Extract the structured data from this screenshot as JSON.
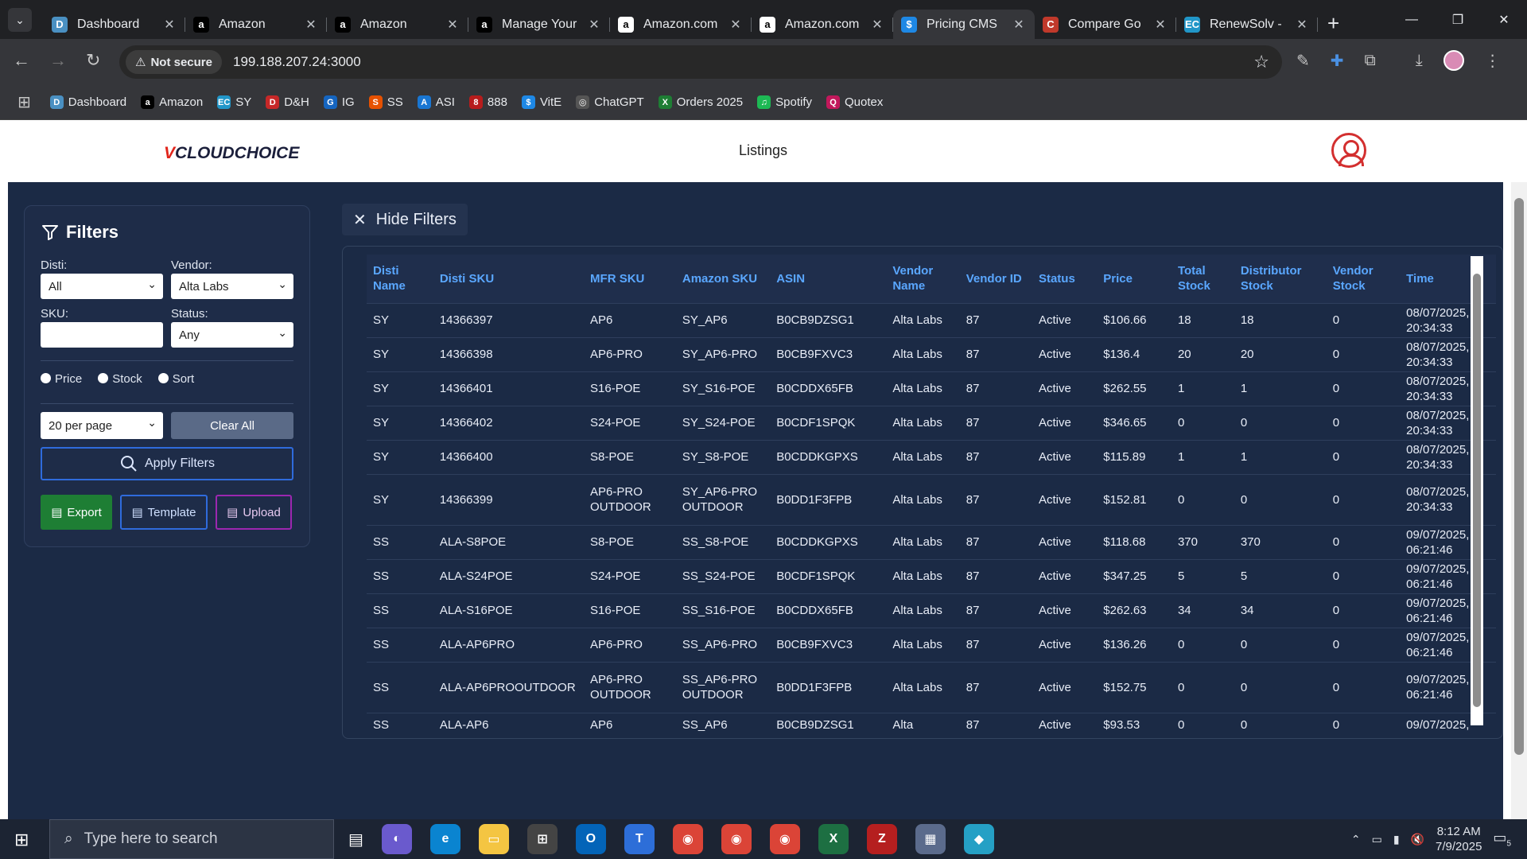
{
  "browser": {
    "tabs": [
      {
        "title": "Dashboard",
        "color": "#4a90c2",
        "glyph": "D"
      },
      {
        "title": "Amazon",
        "color": "#000000",
        "glyph": "a"
      },
      {
        "title": "Amazon",
        "color": "#000000",
        "glyph": "a"
      },
      {
        "title": "Manage Your",
        "color": "#000000",
        "glyph": "a"
      },
      {
        "title": "Amazon.com",
        "color": "#ffffff",
        "glyph": "a"
      },
      {
        "title": "Amazon.com",
        "color": "#ffffff",
        "glyph": "a"
      },
      {
        "title": "Pricing CMS",
        "color": "#1e88e5",
        "glyph": "$",
        "active": true
      },
      {
        "title": "Compare Go",
        "color": "#c0392b",
        "glyph": "C"
      },
      {
        "title": "RenewSolv -",
        "color": "#2196c8",
        "glyph": "EC"
      }
    ],
    "security_label": "Not secure",
    "url": "199.188.207.24:3000",
    "bookmarks": [
      {
        "label": "Dashboard",
        "color": "#4a90c2",
        "glyph": "D"
      },
      {
        "label": "Amazon",
        "color": "#000000",
        "glyph": "a"
      },
      {
        "label": "SY",
        "color": "#2196c8",
        "glyph": "EC"
      },
      {
        "label": "D&H",
        "color": "#c62828",
        "glyph": "D"
      },
      {
        "label": "IG",
        "color": "#1565c0",
        "glyph": "G"
      },
      {
        "label": "SS",
        "color": "#e65100",
        "glyph": "S"
      },
      {
        "label": "ASI",
        "color": "#1976d2",
        "glyph": "A"
      },
      {
        "label": "888",
        "color": "#b71c1c",
        "glyph": "8"
      },
      {
        "label": "VitE",
        "color": "#1e88e5",
        "glyph": "$"
      },
      {
        "label": "ChatGPT",
        "color": "#555555",
        "glyph": "◎"
      },
      {
        "label": "Orders 2025",
        "color": "#1e7e34",
        "glyph": "X"
      },
      {
        "label": "Spotify",
        "color": "#1db954",
        "glyph": "♫"
      },
      {
        "label": "Quotex",
        "color": "#c2185b",
        "glyph": "Q"
      }
    ]
  },
  "app": {
    "logo_red": "V",
    "logo_text": "CLOUDCHOICE",
    "page_title": "Listings"
  },
  "filters": {
    "title": "Filters",
    "disti_label": "Disti:",
    "disti_value": "All",
    "vendor_label": "Vendor:",
    "vendor_value": "Alta Labs",
    "sku_label": "SKU:",
    "sku_value": "",
    "status_label": "Status:",
    "status_value": "Any",
    "radio_price": "Price",
    "radio_stock": "Stock",
    "radio_sort": "Sort",
    "per_page": "20 per page",
    "clear_all": "Clear All",
    "apply": "Apply Filters",
    "export": "Export",
    "template": "Template",
    "upload": "Upload"
  },
  "hide_filters_label": "Hide Filters",
  "table": {
    "headers": [
      "Disti Name",
      "Disti SKU",
      "MFR SKU",
      "Amazon SKU",
      "ASIN",
      "Vendor Name",
      "Vendor ID",
      "Status",
      "Price",
      "Total Stock",
      "Distributor Stock",
      "Vendor Stock",
      "Time"
    ],
    "rows": [
      [
        "SY",
        "14366397",
        "AP6",
        "SY_AP6",
        "B0CB9DZSG1",
        "Alta Labs",
        "87",
        "Active",
        "$106.66",
        "18",
        "18",
        "0",
        "08/07/2025, 20:34:33"
      ],
      [
        "SY",
        "14366398",
        "AP6-PRO",
        "SY_AP6-PRO",
        "B0CB9FXVC3",
        "Alta Labs",
        "87",
        "Active",
        "$136.4",
        "20",
        "20",
        "0",
        "08/07/2025, 20:34:33"
      ],
      [
        "SY",
        "14366401",
        "S16-POE",
        "SY_S16-POE",
        "B0CDDX65FB",
        "Alta Labs",
        "87",
        "Active",
        "$262.55",
        "1",
        "1",
        "0",
        "08/07/2025, 20:34:33"
      ],
      [
        "SY",
        "14366402",
        "S24-POE",
        "SY_S24-POE",
        "B0CDF1SPQK",
        "Alta Labs",
        "87",
        "Active",
        "$346.65",
        "0",
        "0",
        "0",
        "08/07/2025, 20:34:33"
      ],
      [
        "SY",
        "14366400",
        "S8-POE",
        "SY_S8-POE",
        "B0CDDKGPXS",
        "Alta Labs",
        "87",
        "Active",
        "$115.89",
        "1",
        "1",
        "0",
        "08/07/2025, 20:34:33"
      ],
      [
        "SY",
        "14366399",
        "AP6-PRO OUTDOOR",
        "SY_AP6-PRO OUTDOOR",
        "B0DD1F3FPB",
        "Alta Labs",
        "87",
        "Active",
        "$152.81",
        "0",
        "0",
        "0",
        "08/07/2025, 20:34:33"
      ],
      [
        "SS",
        "ALA-S8POE",
        "S8-POE",
        "SS_S8-POE",
        "B0CDDKGPXS",
        "Alta Labs",
        "87",
        "Active",
        "$118.68",
        "370",
        "370",
        "0",
        "09/07/2025, 06:21:46"
      ],
      [
        "SS",
        "ALA-S24POE",
        "S24-POE",
        "SS_S24-POE",
        "B0CDF1SPQK",
        "Alta Labs",
        "87",
        "Active",
        "$347.25",
        "5",
        "5",
        "0",
        "09/07/2025, 06:21:46"
      ],
      [
        "SS",
        "ALA-S16POE",
        "S16-POE",
        "SS_S16-POE",
        "B0CDDX65FB",
        "Alta Labs",
        "87",
        "Active",
        "$262.63",
        "34",
        "34",
        "0",
        "09/07/2025, 06:21:46"
      ],
      [
        "SS",
        "ALA-AP6PRO",
        "AP6-PRO",
        "SS_AP6-PRO",
        "B0CB9FXVC3",
        "Alta Labs",
        "87",
        "Active",
        "$136.26",
        "0",
        "0",
        "0",
        "09/07/2025, 06:21:46"
      ],
      [
        "SS",
        "ALA-AP6PROOUTDOOR",
        "AP6-PRO OUTDOOR",
        "SS_AP6-PRO OUTDOOR",
        "B0DD1F3FPB",
        "Alta Labs",
        "87",
        "Active",
        "$152.75",
        "0",
        "0",
        "0",
        "09/07/2025, 06:21:46"
      ],
      [
        "SS",
        "ALA-AP6",
        "AP6",
        "SS_AP6",
        "B0CB9DZSG1",
        "Alta",
        "87",
        "Active",
        "$93.53",
        "0",
        "0",
        "0",
        "09/07/2025,"
      ]
    ]
  },
  "taskbar": {
    "search_placeholder": "Type here to search",
    "time": "8:12 AM",
    "date": "7/9/2025",
    "notifications": "5"
  }
}
